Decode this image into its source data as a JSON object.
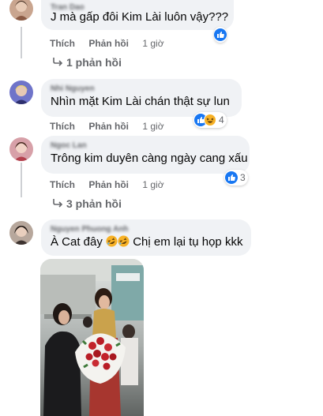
{
  "comments": [
    {
      "author": "Tran Dao",
      "text": "J mà gấp đôi Kim Lài luôn vậy???",
      "like_label": "Thích",
      "reply_label": "Phản hồi",
      "time": "1 giờ",
      "reaction_count": "",
      "replies_label": "1 phản hồi"
    },
    {
      "author": "Nhi Nguyen",
      "text": "Nhìn mặt Kim Lài chán thật sự lun",
      "like_label": "Thích",
      "reply_label": "Phản hồi",
      "time": "1 giờ",
      "reaction_count": "4"
    },
    {
      "author": "Ngoc Lan",
      "text": "Trông kim duyên càng ngày cang xấu",
      "like_label": "Thích",
      "reply_label": "Phản hồi",
      "time": "1 giờ",
      "reaction_count": "3",
      "replies_label": "3 phản hồi"
    },
    {
      "author": "Nguyen Phuong Anh",
      "text_before": "À Cat đây",
      "text_after": "Chị em lại tụ họp kkk"
    }
  ],
  "colors": {
    "bubble_bg": "#f0f2f5",
    "meta_text": "#65676b",
    "like_blue": "#1877f2",
    "haha_yellow": "#f7b125"
  },
  "icons": {
    "like": "like-reaction-icon",
    "haha": "haha-reaction-icon",
    "reply_arrow": "reply-arrow-icon",
    "rofl": "rofl-emoji-icon"
  }
}
